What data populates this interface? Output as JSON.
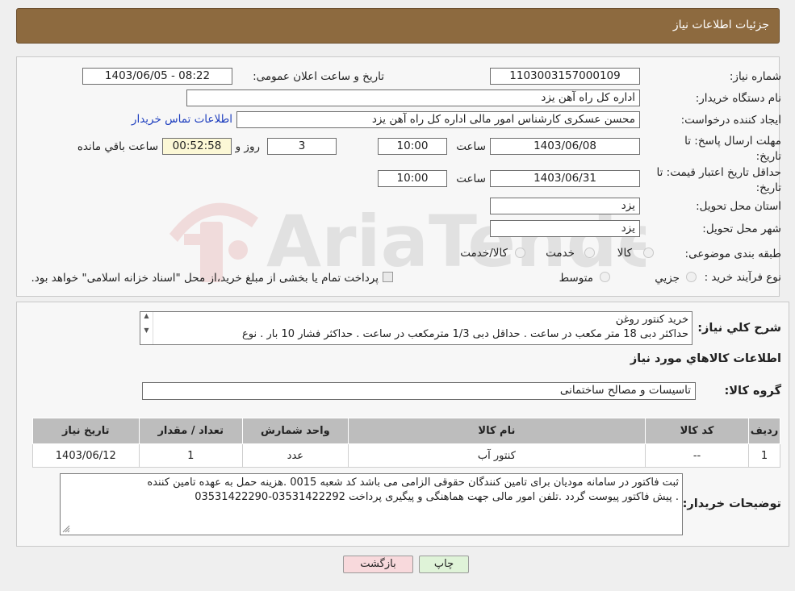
{
  "header": {
    "title": "جزئیات اطلاعات نیاز"
  },
  "form": {
    "need_number_label": "شماره نیاز:",
    "need_number": "1103003157000109",
    "announce_label": "تاریخ و ساعت اعلان عمومی:",
    "announce_value": "1403/06/05 - 08:22",
    "buyer_label": "نام دستگاه خریدار:",
    "buyer_value": "اداره کل راه آهن یزد",
    "creator_label": "ایجاد کننده درخواست:",
    "creator_value": "محسن عسکری کارشناس امور مالی اداره کل راه آهن یزد",
    "contact_link": "اطلاعات تماس خریدار",
    "deadline_label": "مهلت ارسال پاسخ: تا تاریخ:",
    "deadline_date": "1403/06/08",
    "time_label": "ساعت",
    "deadline_time": "10:00",
    "days_value": "3",
    "days_label": "روز و",
    "remaining_value": "00:52:58",
    "remaining_label": "ساعت باقي مانده",
    "validity_label": "حداقل تاريخ اعتبار قيمت: تا تاریخ:",
    "validity_date": "1403/06/31",
    "validity_time": "10:00",
    "province_label": "استان محل تحویل:",
    "province_value": "یزد",
    "city_label": "شهر محل تحویل:",
    "city_value": "یزد",
    "category_label": "طبقه بندی موضوعی:",
    "category_opt1": "کالا",
    "category_opt2": "خدمت",
    "category_opt3": "کالا/خدمت",
    "process_label": "نوع فرآیند خرید :",
    "process_opt1": "جزيي",
    "process_opt2": "متوسط",
    "process_note": "پرداخت تمام یا بخشی از مبلغ خرید،از محل \"اسناد خزانه اسلامی\" خواهد بود."
  },
  "details": {
    "summary_label": "شرح کلي نياز:",
    "summary_line1": "خرید کنتور روغن",
    "summary_line2": "حداکثر دبی 18 متر مکعب در ساعت . حداقل دبی 1/3 مترمکعب در ساعت . حداکثر فشار 10 بار . نوع",
    "goods_title": "اطلاعات کالاهاي مورد نياز",
    "group_label": "گروه کالا:",
    "group_value": "تاسیسات و مصالح ساختمانی"
  },
  "table": {
    "headers": [
      "رديف",
      "کد کالا",
      "نام کالا",
      "واحد شمارش",
      "تعداد / مقدار",
      "تاریخ نیاز"
    ],
    "rows": [
      [
        "1",
        "--",
        "کنتور آب",
        "عدد",
        "1",
        "1403/06/12"
      ]
    ]
  },
  "buyer_notes": {
    "label": "توضیحات خریدار:",
    "line1": "ثبت فاکتور در سامانه مودیان برای تامین کنندگان حقوقی الزامی می باشد کد شعبه 0015 .هزینه حمل به عهده تامین کننده",
    "line2": ". پیش فاکتور پیوست گردد .تلفن امور مالی جهت هماهنگی و پیگیری پرداخت 03531422292-03531422290"
  },
  "buttons": {
    "print": "چاپ",
    "back": "بازگشت"
  },
  "watermark": {
    "text": "AriaTender.neT"
  },
  "colors": {
    "header": "#8d6a3f",
    "link": "#1f3fbf",
    "back_button": "#f8d9dc",
    "print_button": "#dff3d8"
  }
}
